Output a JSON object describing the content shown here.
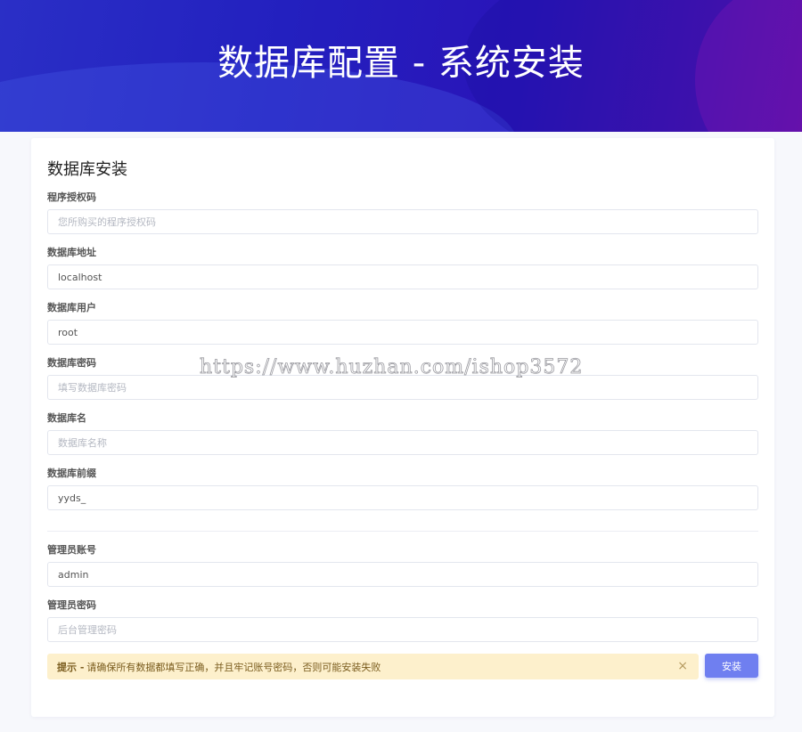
{
  "header": {
    "title": "数据库配置 - 系统安装"
  },
  "card": {
    "title": "数据库安装"
  },
  "fields": [
    {
      "label": "程序授权码",
      "value": "",
      "placeholder": "您所购买的程序授权码"
    },
    {
      "label": "数据库地址",
      "value": "localhost",
      "placeholder": ""
    },
    {
      "label": "数据库用户",
      "value": "root",
      "placeholder": ""
    },
    {
      "label": "数据库密码",
      "value": "",
      "placeholder": "填写数据库密码"
    },
    {
      "label": "数据库名",
      "value": "",
      "placeholder": "数据库名称"
    },
    {
      "label": "数据库前缀",
      "value": "yyds_",
      "placeholder": ""
    },
    {
      "label": "管理员账号",
      "value": "admin",
      "placeholder": ""
    },
    {
      "label": "管理员密码",
      "value": "",
      "placeholder": "后台管理密码"
    }
  ],
  "alert": {
    "strong": "提示 -",
    "text": "请确保所有数据都填写正确，并且牢记账号密码，否则可能安装失败",
    "close_glyph": "×"
  },
  "buttons": {
    "install": "安装"
  },
  "watermark": "https://www.huzhan.com/ishop3572",
  "colors": {
    "header_gradient_start": "#2a2fc6",
    "header_gradient_end": "#6d12ad",
    "button": "#6f7ff0",
    "alert_bg": "#fdf0cc"
  }
}
